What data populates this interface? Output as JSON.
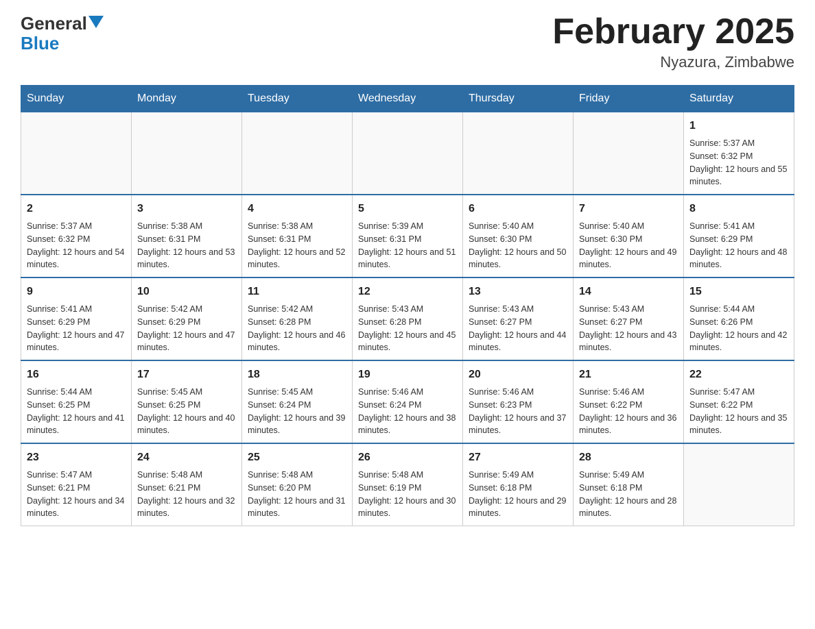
{
  "header": {
    "logo_general": "General",
    "logo_blue": "Blue",
    "month_title": "February 2025",
    "location": "Nyazura, Zimbabwe"
  },
  "days_of_week": [
    "Sunday",
    "Monday",
    "Tuesday",
    "Wednesday",
    "Thursday",
    "Friday",
    "Saturday"
  ],
  "weeks": [
    [
      {
        "day": "",
        "empty": true
      },
      {
        "day": "",
        "empty": true
      },
      {
        "day": "",
        "empty": true
      },
      {
        "day": "",
        "empty": true
      },
      {
        "day": "",
        "empty": true
      },
      {
        "day": "",
        "empty": true
      },
      {
        "day": "1",
        "sunrise": "5:37 AM",
        "sunset": "6:32 PM",
        "daylight": "12 hours and 55 minutes."
      }
    ],
    [
      {
        "day": "2",
        "sunrise": "5:37 AM",
        "sunset": "6:32 PM",
        "daylight": "12 hours and 54 minutes."
      },
      {
        "day": "3",
        "sunrise": "5:38 AM",
        "sunset": "6:31 PM",
        "daylight": "12 hours and 53 minutes."
      },
      {
        "day": "4",
        "sunrise": "5:38 AM",
        "sunset": "6:31 PM",
        "daylight": "12 hours and 52 minutes."
      },
      {
        "day": "5",
        "sunrise": "5:39 AM",
        "sunset": "6:31 PM",
        "daylight": "12 hours and 51 minutes."
      },
      {
        "day": "6",
        "sunrise": "5:40 AM",
        "sunset": "6:30 PM",
        "daylight": "12 hours and 50 minutes."
      },
      {
        "day": "7",
        "sunrise": "5:40 AM",
        "sunset": "6:30 PM",
        "daylight": "12 hours and 49 minutes."
      },
      {
        "day": "8",
        "sunrise": "5:41 AM",
        "sunset": "6:29 PM",
        "daylight": "12 hours and 48 minutes."
      }
    ],
    [
      {
        "day": "9",
        "sunrise": "5:41 AM",
        "sunset": "6:29 PM",
        "daylight": "12 hours and 47 minutes."
      },
      {
        "day": "10",
        "sunrise": "5:42 AM",
        "sunset": "6:29 PM",
        "daylight": "12 hours and 47 minutes."
      },
      {
        "day": "11",
        "sunrise": "5:42 AM",
        "sunset": "6:28 PM",
        "daylight": "12 hours and 46 minutes."
      },
      {
        "day": "12",
        "sunrise": "5:43 AM",
        "sunset": "6:28 PM",
        "daylight": "12 hours and 45 minutes."
      },
      {
        "day": "13",
        "sunrise": "5:43 AM",
        "sunset": "6:27 PM",
        "daylight": "12 hours and 44 minutes."
      },
      {
        "day": "14",
        "sunrise": "5:43 AM",
        "sunset": "6:27 PM",
        "daylight": "12 hours and 43 minutes."
      },
      {
        "day": "15",
        "sunrise": "5:44 AM",
        "sunset": "6:26 PM",
        "daylight": "12 hours and 42 minutes."
      }
    ],
    [
      {
        "day": "16",
        "sunrise": "5:44 AM",
        "sunset": "6:25 PM",
        "daylight": "12 hours and 41 minutes."
      },
      {
        "day": "17",
        "sunrise": "5:45 AM",
        "sunset": "6:25 PM",
        "daylight": "12 hours and 40 minutes."
      },
      {
        "day": "18",
        "sunrise": "5:45 AM",
        "sunset": "6:24 PM",
        "daylight": "12 hours and 39 minutes."
      },
      {
        "day": "19",
        "sunrise": "5:46 AM",
        "sunset": "6:24 PM",
        "daylight": "12 hours and 38 minutes."
      },
      {
        "day": "20",
        "sunrise": "5:46 AM",
        "sunset": "6:23 PM",
        "daylight": "12 hours and 37 minutes."
      },
      {
        "day": "21",
        "sunrise": "5:46 AM",
        "sunset": "6:22 PM",
        "daylight": "12 hours and 36 minutes."
      },
      {
        "day": "22",
        "sunrise": "5:47 AM",
        "sunset": "6:22 PM",
        "daylight": "12 hours and 35 minutes."
      }
    ],
    [
      {
        "day": "23",
        "sunrise": "5:47 AM",
        "sunset": "6:21 PM",
        "daylight": "12 hours and 34 minutes."
      },
      {
        "day": "24",
        "sunrise": "5:48 AM",
        "sunset": "6:21 PM",
        "daylight": "12 hours and 32 minutes."
      },
      {
        "day": "25",
        "sunrise": "5:48 AM",
        "sunset": "6:20 PM",
        "daylight": "12 hours and 31 minutes."
      },
      {
        "day": "26",
        "sunrise": "5:48 AM",
        "sunset": "6:19 PM",
        "daylight": "12 hours and 30 minutes."
      },
      {
        "day": "27",
        "sunrise": "5:49 AM",
        "sunset": "6:18 PM",
        "daylight": "12 hours and 29 minutes."
      },
      {
        "day": "28",
        "sunrise": "5:49 AM",
        "sunset": "6:18 PM",
        "daylight": "12 hours and 28 minutes."
      },
      {
        "day": "",
        "empty": true
      }
    ]
  ],
  "labels": {
    "sunrise": "Sunrise:",
    "sunset": "Sunset:",
    "daylight": "Daylight:"
  }
}
